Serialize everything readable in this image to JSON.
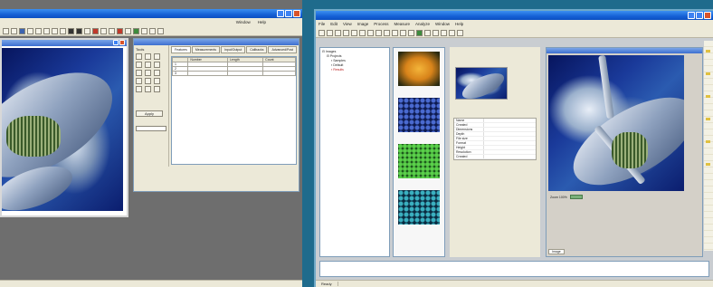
{
  "left_window": {
    "menu": [
      "",
      "Window",
      "Help"
    ],
    "dialog_title": "",
    "tabs": [
      "Features",
      "Measurements",
      "Input/Output",
      "Callbacks",
      "Advanced/Post"
    ],
    "table_headers": [
      "",
      "Number",
      "Length",
      "Count"
    ],
    "table_rows": [
      [
        "1",
        "",
        "",
        ""
      ],
      [
        "2",
        "",
        "",
        ""
      ],
      [
        "3",
        "",
        "",
        ""
      ]
    ],
    "tools_label": "Tools",
    "apply_label": "Apply",
    "status": [
      "",
      "",
      "",
      "",
      ""
    ]
  },
  "right_window": {
    "title": "",
    "menu": [
      "File",
      "Edit",
      "View",
      "Image",
      "Process",
      "Measure",
      "Analyze",
      "Window",
      "Help"
    ],
    "tree_items": [
      "Images",
      "Projects",
      "Samples",
      "Default",
      "Results"
    ],
    "thumb_labels": [
      "",
      "",
      "",
      ""
    ],
    "properties": [
      {
        "k": "Name",
        "v": ""
      },
      {
        "k": "Created",
        "v": ""
      },
      {
        "k": "Dimensions",
        "v": ""
      },
      {
        "k": "Depth",
        "v": ""
      },
      {
        "k": "File size",
        "v": ""
      },
      {
        "k": "Format",
        "v": ""
      },
      {
        "k": "Height",
        "v": ""
      },
      {
        "k": "Resolution",
        "v": ""
      },
      {
        "k": "Created",
        "v": ""
      }
    ],
    "image_label": "Zoom 100%",
    "image_tab": "Image",
    "status": [
      "Ready",
      "",
      "",
      ""
    ]
  },
  "colors": {
    "desktop": "#1f6b8c",
    "titlebar": "#1560d6",
    "chrome": "#ece9d8"
  }
}
